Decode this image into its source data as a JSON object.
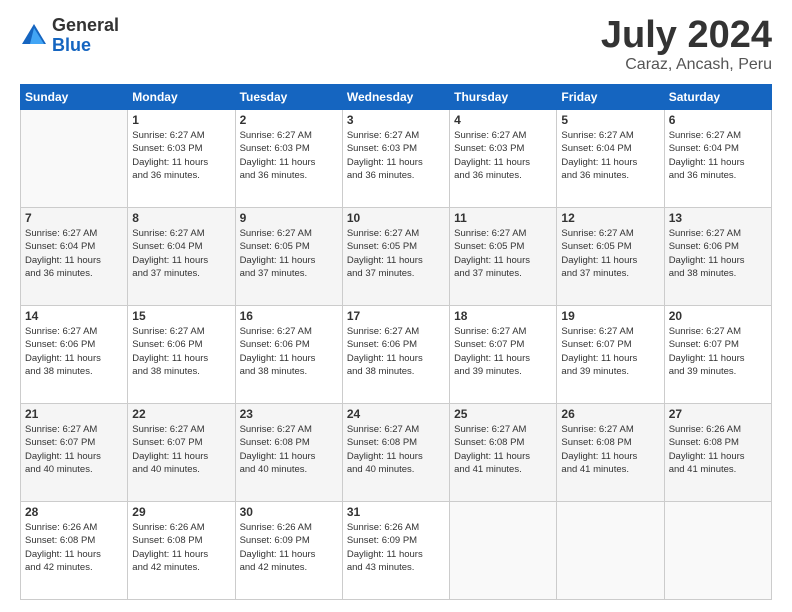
{
  "header": {
    "logo_general": "General",
    "logo_blue": "Blue",
    "month_title": "July 2024",
    "subtitle": "Caraz, Ancash, Peru"
  },
  "days_of_week": [
    "Sunday",
    "Monday",
    "Tuesday",
    "Wednesday",
    "Thursday",
    "Friday",
    "Saturday"
  ],
  "weeks": [
    [
      {
        "num": "",
        "sunrise": "",
        "sunset": "",
        "daylight": "",
        "empty": true
      },
      {
        "num": "1",
        "sunrise": "Sunrise: 6:27 AM",
        "sunset": "Sunset: 6:03 PM",
        "daylight": "Daylight: 11 hours and 36 minutes."
      },
      {
        "num": "2",
        "sunrise": "Sunrise: 6:27 AM",
        "sunset": "Sunset: 6:03 PM",
        "daylight": "Daylight: 11 hours and 36 minutes."
      },
      {
        "num": "3",
        "sunrise": "Sunrise: 6:27 AM",
        "sunset": "Sunset: 6:03 PM",
        "daylight": "Daylight: 11 hours and 36 minutes."
      },
      {
        "num": "4",
        "sunrise": "Sunrise: 6:27 AM",
        "sunset": "Sunset: 6:03 PM",
        "daylight": "Daylight: 11 hours and 36 minutes."
      },
      {
        "num": "5",
        "sunrise": "Sunrise: 6:27 AM",
        "sunset": "Sunset: 6:04 PM",
        "daylight": "Daylight: 11 hours and 36 minutes."
      },
      {
        "num": "6",
        "sunrise": "Sunrise: 6:27 AM",
        "sunset": "Sunset: 6:04 PM",
        "daylight": "Daylight: 11 hours and 36 minutes."
      }
    ],
    [
      {
        "num": "7",
        "sunrise": "Sunrise: 6:27 AM",
        "sunset": "Sunset: 6:04 PM",
        "daylight": "Daylight: 11 hours and 36 minutes."
      },
      {
        "num": "8",
        "sunrise": "Sunrise: 6:27 AM",
        "sunset": "Sunset: 6:04 PM",
        "daylight": "Daylight: 11 hours and 37 minutes."
      },
      {
        "num": "9",
        "sunrise": "Sunrise: 6:27 AM",
        "sunset": "Sunset: 6:05 PM",
        "daylight": "Daylight: 11 hours and 37 minutes."
      },
      {
        "num": "10",
        "sunrise": "Sunrise: 6:27 AM",
        "sunset": "Sunset: 6:05 PM",
        "daylight": "Daylight: 11 hours and 37 minutes."
      },
      {
        "num": "11",
        "sunrise": "Sunrise: 6:27 AM",
        "sunset": "Sunset: 6:05 PM",
        "daylight": "Daylight: 11 hours and 37 minutes."
      },
      {
        "num": "12",
        "sunrise": "Sunrise: 6:27 AM",
        "sunset": "Sunset: 6:05 PM",
        "daylight": "Daylight: 11 hours and 37 minutes."
      },
      {
        "num": "13",
        "sunrise": "Sunrise: 6:27 AM",
        "sunset": "Sunset: 6:06 PM",
        "daylight": "Daylight: 11 hours and 38 minutes."
      }
    ],
    [
      {
        "num": "14",
        "sunrise": "Sunrise: 6:27 AM",
        "sunset": "Sunset: 6:06 PM",
        "daylight": "Daylight: 11 hours and 38 minutes."
      },
      {
        "num": "15",
        "sunrise": "Sunrise: 6:27 AM",
        "sunset": "Sunset: 6:06 PM",
        "daylight": "Daylight: 11 hours and 38 minutes."
      },
      {
        "num": "16",
        "sunrise": "Sunrise: 6:27 AM",
        "sunset": "Sunset: 6:06 PM",
        "daylight": "Daylight: 11 hours and 38 minutes."
      },
      {
        "num": "17",
        "sunrise": "Sunrise: 6:27 AM",
        "sunset": "Sunset: 6:06 PM",
        "daylight": "Daylight: 11 hours and 38 minutes."
      },
      {
        "num": "18",
        "sunrise": "Sunrise: 6:27 AM",
        "sunset": "Sunset: 6:07 PM",
        "daylight": "Daylight: 11 hours and 39 minutes."
      },
      {
        "num": "19",
        "sunrise": "Sunrise: 6:27 AM",
        "sunset": "Sunset: 6:07 PM",
        "daylight": "Daylight: 11 hours and 39 minutes."
      },
      {
        "num": "20",
        "sunrise": "Sunrise: 6:27 AM",
        "sunset": "Sunset: 6:07 PM",
        "daylight": "Daylight: 11 hours and 39 minutes."
      }
    ],
    [
      {
        "num": "21",
        "sunrise": "Sunrise: 6:27 AM",
        "sunset": "Sunset: 6:07 PM",
        "daylight": "Daylight: 11 hours and 40 minutes."
      },
      {
        "num": "22",
        "sunrise": "Sunrise: 6:27 AM",
        "sunset": "Sunset: 6:07 PM",
        "daylight": "Daylight: 11 hours and 40 minutes."
      },
      {
        "num": "23",
        "sunrise": "Sunrise: 6:27 AM",
        "sunset": "Sunset: 6:08 PM",
        "daylight": "Daylight: 11 hours and 40 minutes."
      },
      {
        "num": "24",
        "sunrise": "Sunrise: 6:27 AM",
        "sunset": "Sunset: 6:08 PM",
        "daylight": "Daylight: 11 hours and 40 minutes."
      },
      {
        "num": "25",
        "sunrise": "Sunrise: 6:27 AM",
        "sunset": "Sunset: 6:08 PM",
        "daylight": "Daylight: 11 hours and 41 minutes."
      },
      {
        "num": "26",
        "sunrise": "Sunrise: 6:27 AM",
        "sunset": "Sunset: 6:08 PM",
        "daylight": "Daylight: 11 hours and 41 minutes."
      },
      {
        "num": "27",
        "sunrise": "Sunrise: 6:26 AM",
        "sunset": "Sunset: 6:08 PM",
        "daylight": "Daylight: 11 hours and 41 minutes."
      }
    ],
    [
      {
        "num": "28",
        "sunrise": "Sunrise: 6:26 AM",
        "sunset": "Sunset: 6:08 PM",
        "daylight": "Daylight: 11 hours and 42 minutes."
      },
      {
        "num": "29",
        "sunrise": "Sunrise: 6:26 AM",
        "sunset": "Sunset: 6:08 PM",
        "daylight": "Daylight: 11 hours and 42 minutes."
      },
      {
        "num": "30",
        "sunrise": "Sunrise: 6:26 AM",
        "sunset": "Sunset: 6:09 PM",
        "daylight": "Daylight: 11 hours and 42 minutes."
      },
      {
        "num": "31",
        "sunrise": "Sunrise: 6:26 AM",
        "sunset": "Sunset: 6:09 PM",
        "daylight": "Daylight: 11 hours and 43 minutes."
      },
      {
        "num": "",
        "sunrise": "",
        "sunset": "",
        "daylight": "",
        "empty": true
      },
      {
        "num": "",
        "sunrise": "",
        "sunset": "",
        "daylight": "",
        "empty": true
      },
      {
        "num": "",
        "sunrise": "",
        "sunset": "",
        "daylight": "",
        "empty": true
      }
    ]
  ]
}
